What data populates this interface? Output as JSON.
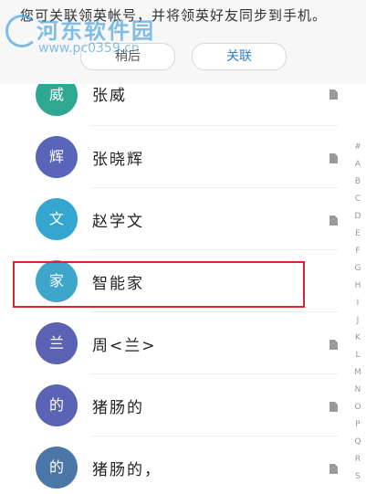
{
  "banner": {
    "text": "您可关联领英帐号，并将领英好友同步到手机。",
    "later_label": "稍后",
    "link_label": "关联"
  },
  "watermark": {
    "title": "河东软件园",
    "url": "www.pc0359.cn"
  },
  "contacts": [
    {
      "avatar_char": "威",
      "name": "张威",
      "color": "#2fa892",
      "has_file": true
    },
    {
      "avatar_char": "辉",
      "name": "张晓辉",
      "color": "#5865b8",
      "has_file": true
    },
    {
      "avatar_char": "文",
      "name": "赵学文",
      "color": "#35a6cf",
      "has_file": true
    },
    {
      "avatar_char": "家",
      "name": "智能家",
      "color": "#3ea5cb",
      "has_file": false
    },
    {
      "avatar_char": "兰",
      "name": "周<兰>",
      "color": "#5b62b4",
      "has_file": true
    },
    {
      "avatar_char": "的",
      "name": "猪肠的",
      "color": "#5a63b5",
      "has_file": true
    },
    {
      "avatar_char": "的",
      "name": "猪肠的，",
      "color": "#4a76a8",
      "has_file": true
    }
  ],
  "index_letters": [
    "#",
    "A",
    "B",
    "C",
    "D",
    "E",
    "F",
    "G",
    "H",
    "I",
    "J",
    "K",
    "L",
    "M",
    "N",
    "O",
    "P",
    "Q",
    "R",
    "S"
  ],
  "colors": {
    "highlight_border": "#d9252b",
    "link_accent": "#2e7fcf"
  }
}
